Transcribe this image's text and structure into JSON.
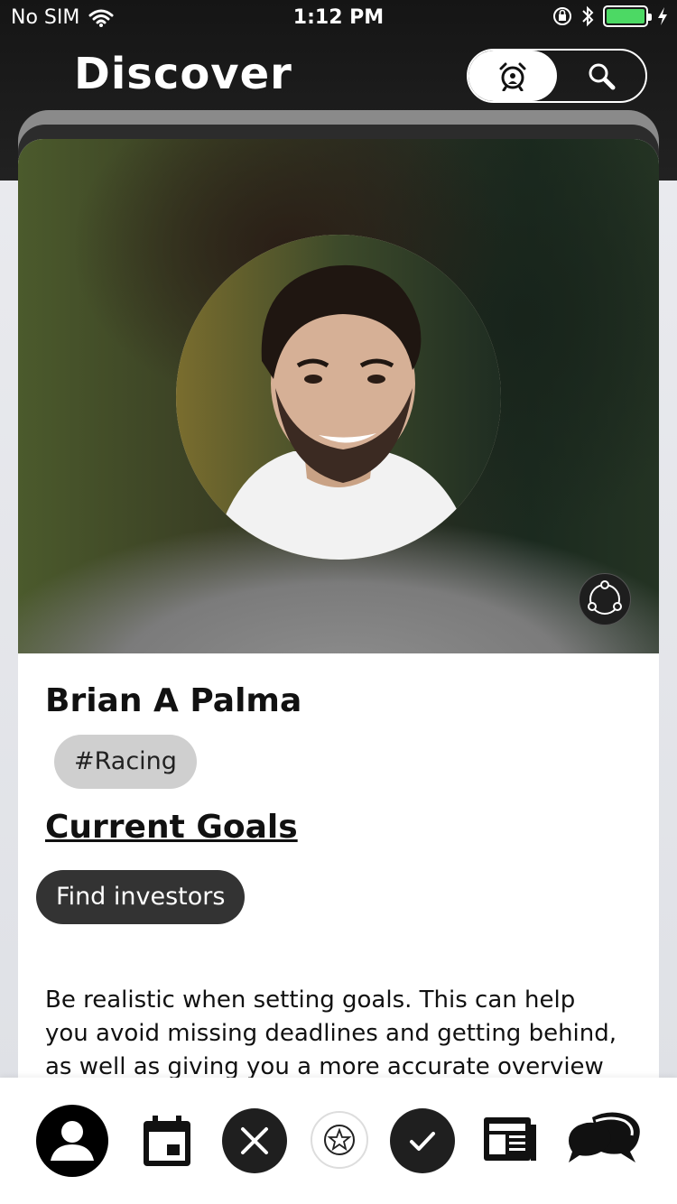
{
  "status_bar": {
    "carrier": "No SIM",
    "time": "1:12 PM",
    "battery_color": "#4cd964"
  },
  "header": {
    "title": "Discover",
    "toggle": {
      "left_icon": "alarm-clock-icon",
      "right_icon": "search-icon",
      "active": "left"
    }
  },
  "profile": {
    "name": "Brian A Palma",
    "tag": "#Racing",
    "goals_heading": "Current Goals",
    "goals": [
      "Find investors"
    ],
    "description": "Be realistic when setting goals. This can help you avoid missing deadlines and getting behind, as well as giving you a more accurate overview",
    "share_icon": "share-icon"
  },
  "bottom_nav": {
    "items": [
      {
        "icon": "profile-icon"
      },
      {
        "icon": "calendar-icon"
      },
      {
        "icon": "reject-icon"
      },
      {
        "icon": "favorite-star-icon"
      },
      {
        "icon": "accept-check-icon"
      },
      {
        "icon": "news-icon"
      },
      {
        "icon": "chat-icon"
      }
    ]
  }
}
